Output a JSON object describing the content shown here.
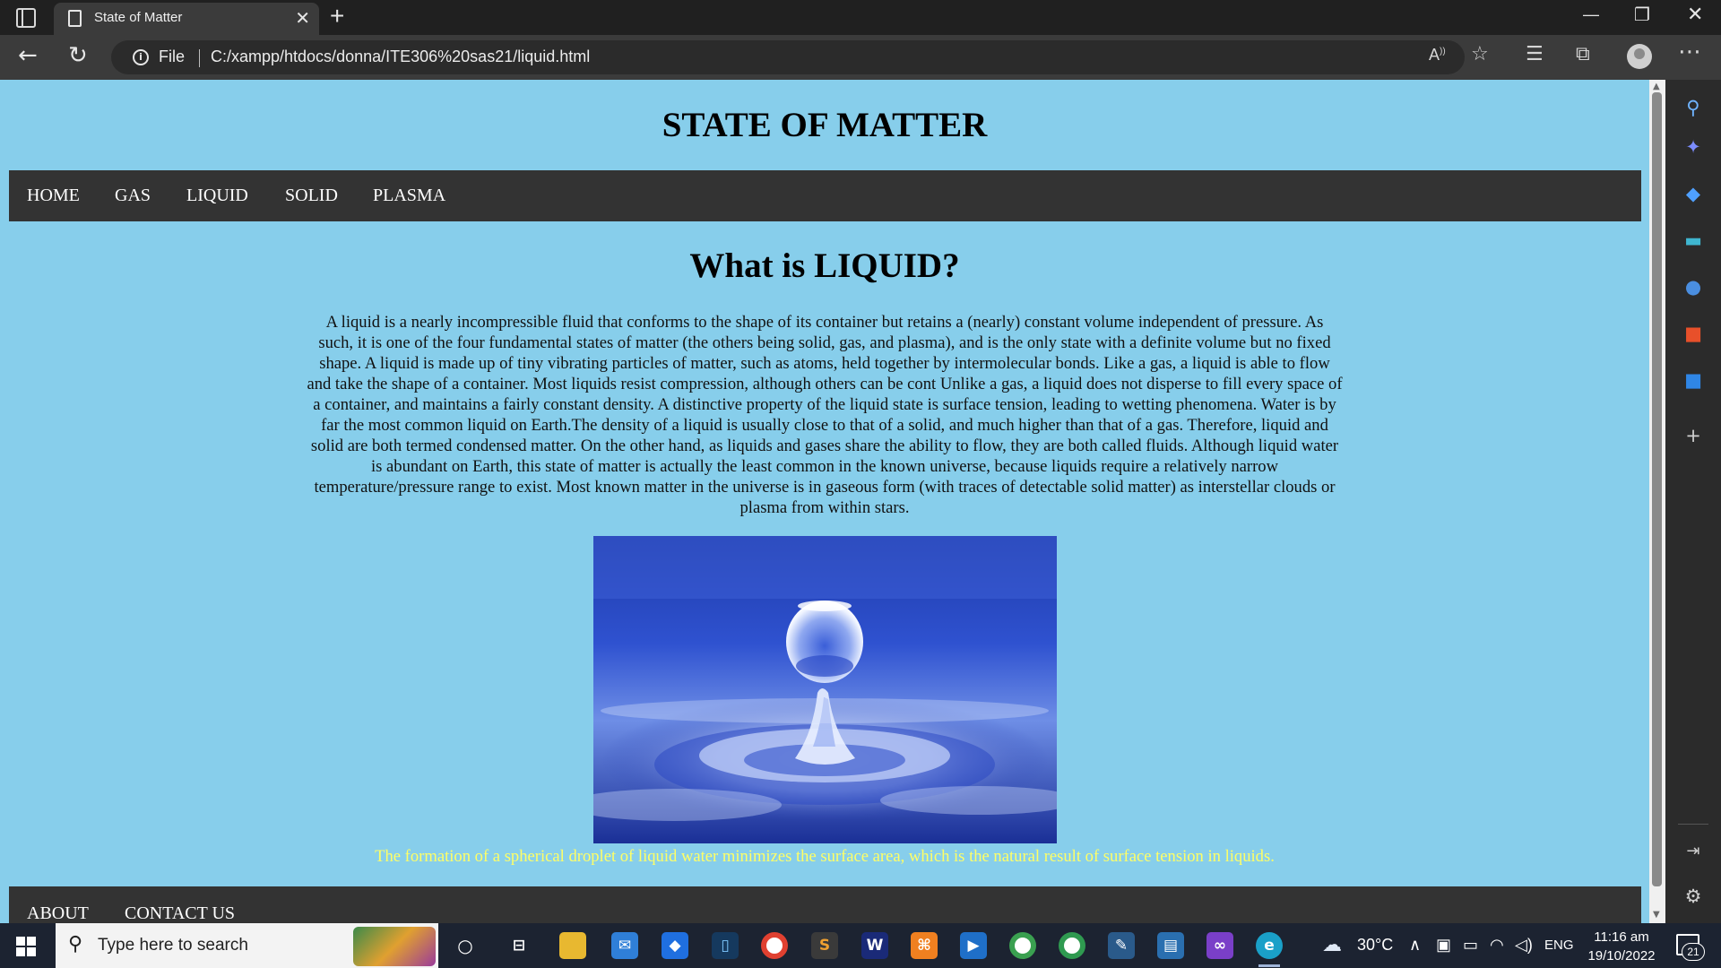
{
  "browser": {
    "tab_title": "State of Matter",
    "tab_close": "✕",
    "new_tab": "+",
    "address_scheme": "File",
    "address_url": "C:/xampp/htdocs/donna/ITE306%20sas21/liquid.html",
    "window_controls": [
      "minimize",
      "restore",
      "close"
    ]
  },
  "page": {
    "site_title": "STATE OF MATTER",
    "nav": [
      "HOME",
      "GAS",
      "LIQUID",
      "SOLID",
      "PLASMA"
    ],
    "heading": "What is LIQUID?",
    "paragraph": "A liquid is a nearly incompressible fluid that conforms to the shape of its container but retains a (nearly) constant volume independent of pressure. As such, it is one of the four fundamental states of matter (the others being solid, gas, and plasma), and is the only state with a definite volume but no fixed shape. A liquid is made up of tiny vibrating particles of matter, such as atoms, held together by intermolecular bonds. Like a gas, a liquid is able to flow and take the shape of a container. Most liquids resist compression, although others can be cont Unlike a gas, a liquid does not disperse to fill every space of a container, and maintains a fairly constant density. A distinctive property of the liquid state is surface tension, leading to wetting phenomena. Water is by far the most common liquid on Earth.The density of a liquid is usually close to that of a solid, and much higher than that of a gas. Therefore, liquid and solid are both termed condensed matter. On the other hand, as liquids and gases share the ability to flow, they are both called fluids. Although liquid water is abundant on Earth, this state of matter is actually the least common in the known universe, because liquids require a relatively narrow temperature/pressure range to exist. Most known matter in the universe is in gaseous form (with traces of detectable solid matter) as interstellar clouds or plasma from within stars.",
    "caption": "The formation of a spherical droplet of liquid water minimizes the surface area, which is the natural result of surface tension in liquids.",
    "footer": [
      "ABOUT",
      "CONTACT US"
    ]
  },
  "colors": {
    "page_background": "#87ceeb",
    "nav_background": "#333333",
    "caption": "#ffff66"
  },
  "taskbar": {
    "search_placeholder": "Type here to search",
    "temperature": "30°C",
    "language": "ENG",
    "time": "11:16 am",
    "date": "19/10/2022",
    "notification_count": "21"
  }
}
